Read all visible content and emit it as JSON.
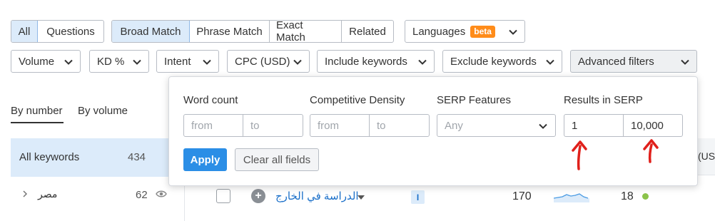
{
  "match_tabs": {
    "group1": [
      "All",
      "Questions"
    ],
    "group2": [
      "Broad Match",
      "Phrase Match",
      "Exact Match",
      "Related"
    ],
    "active": [
      "All",
      "Broad Match"
    ]
  },
  "languages": {
    "label": "Languages",
    "badge": "beta"
  },
  "filters": [
    "Volume",
    "KD %",
    "Intent",
    "CPC (USD)",
    "Include keywords",
    "Exclude keywords",
    "Advanced filters"
  ],
  "view_tabs": {
    "by_number": "By number",
    "by_volume": "By volume"
  },
  "sidebar": {
    "all_label": "All keywords",
    "all_count": "434",
    "item_label": "مصر",
    "item_count": "62"
  },
  "advanced_popup": {
    "word_count": {
      "label": "Word count",
      "from_placeholder": "from",
      "to_placeholder": "to"
    },
    "competitive_density": {
      "label": "Competitive Density",
      "from_placeholder": "from",
      "to_placeholder": "to"
    },
    "serp_features": {
      "label": "SERP Features",
      "value": "Any"
    },
    "results_in_serp": {
      "label": "Results in SERP",
      "from_value": "1",
      "to_value": "10,000"
    },
    "apply_label": "Apply",
    "clear_label": "Clear all fields"
  },
  "table": {
    "cpc_header_fragment": "(US",
    "row": {
      "keyword": "الدراسة في الخارج",
      "intent": "I",
      "volume": "170",
      "kd": "18"
    }
  },
  "colors": {
    "accent": "#2b8ee6",
    "active_tab_bg": "#dcebfa",
    "beta": "#ff8c1a",
    "kd_dot": "#8bc34a",
    "arrow": "#e0201b"
  }
}
